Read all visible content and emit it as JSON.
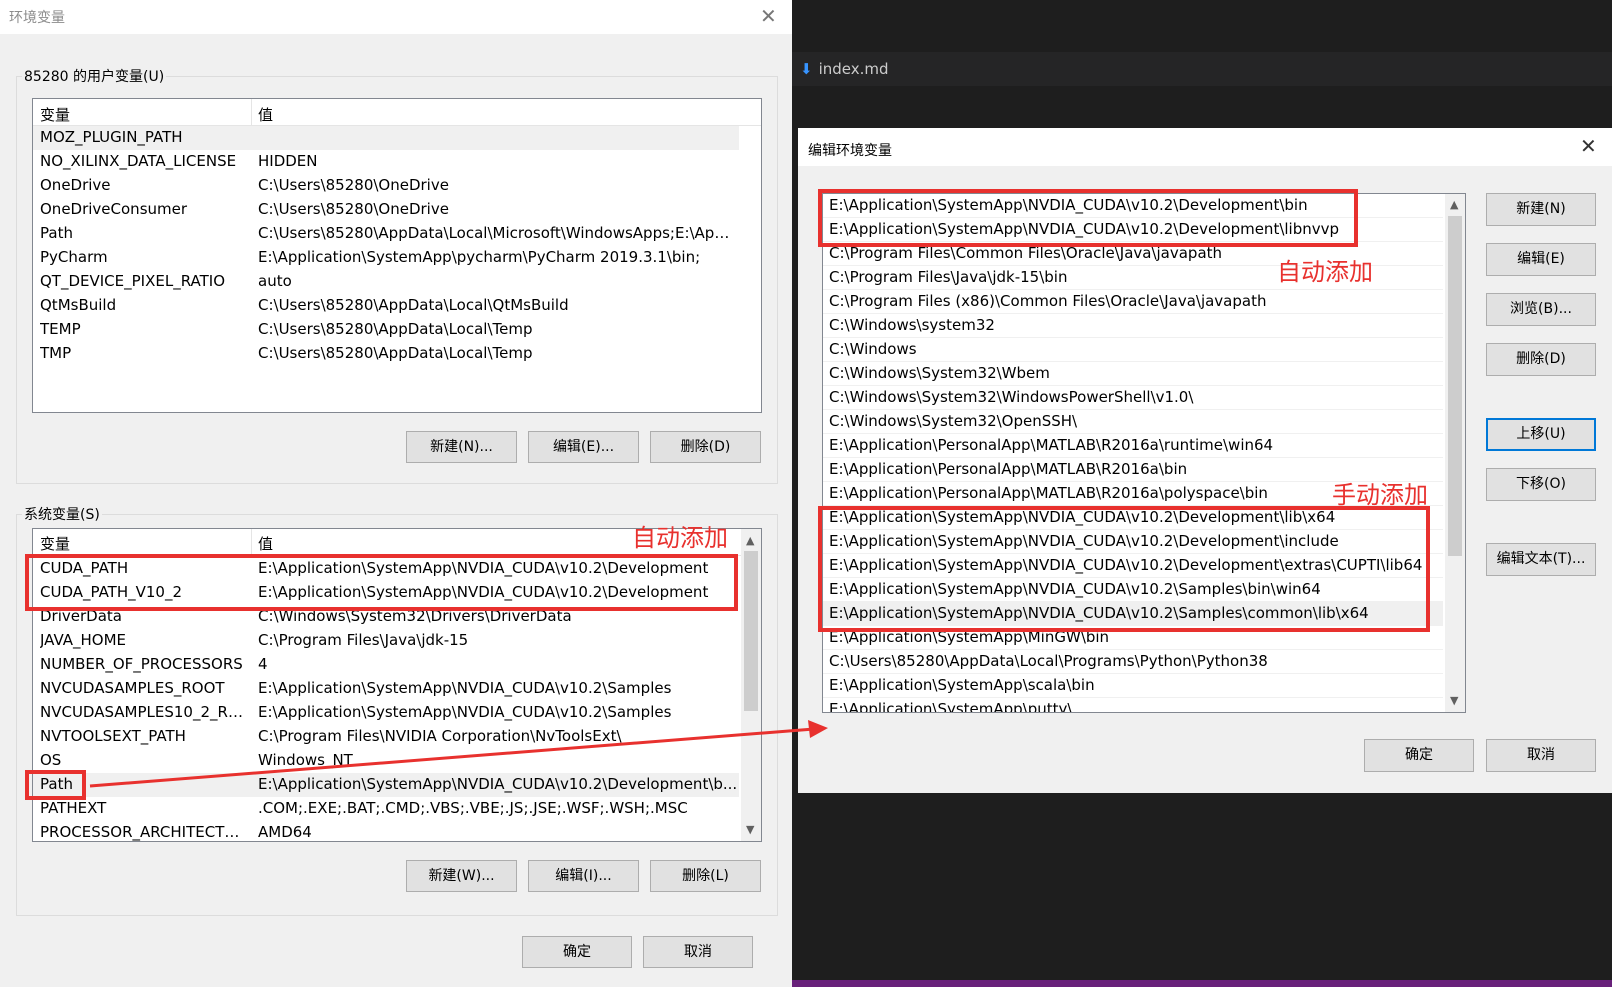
{
  "env_dialog": {
    "title": "环境变量",
    "close": "✕",
    "user_group_label": "85280 的用户变量(U)",
    "columns": [
      "变量",
      "值"
    ],
    "user_vars": [
      {
        "name": "MOZ_PLUGIN_PATH",
        "value": ""
      },
      {
        "name": "NO_XILINX_DATA_LICENSE",
        "value": "HIDDEN"
      },
      {
        "name": "OneDrive",
        "value": "C:\\Users\\85280\\OneDrive"
      },
      {
        "name": "OneDriveConsumer",
        "value": "C:\\Users\\85280\\OneDrive"
      },
      {
        "name": "Path",
        "value": "C:\\Users\\85280\\AppData\\Local\\Microsoft\\WindowsApps;E:\\Applic..."
      },
      {
        "name": "PyCharm",
        "value": "E:\\Application\\SystemApp\\pycharm\\PyCharm 2019.3.1\\bin;"
      },
      {
        "name": "QT_DEVICE_PIXEL_RATIO",
        "value": "auto"
      },
      {
        "name": "QtMsBuild",
        "value": "C:\\Users\\85280\\AppData\\Local\\QtMsBuild"
      },
      {
        "name": "TEMP",
        "value": "C:\\Users\\85280\\AppData\\Local\\Temp"
      },
      {
        "name": "TMP",
        "value": "C:\\Users\\85280\\AppData\\Local\\Temp"
      }
    ],
    "user_buttons": {
      "new": "新建(N)...",
      "edit": "编辑(E)...",
      "delete": "删除(D)"
    },
    "system_group_label": "系统变量(S)",
    "system_vars": [
      {
        "name": "CUDA_PATH",
        "value": "E:\\Application\\SystemApp\\NVDIA_CUDA\\v10.2\\Development"
      },
      {
        "name": "CUDA_PATH_V10_2",
        "value": "E:\\Application\\SystemApp\\NVDIA_CUDA\\v10.2\\Development"
      },
      {
        "name": "DriverData",
        "value": "C:\\Windows\\System32\\Drivers\\DriverData"
      },
      {
        "name": "JAVA_HOME",
        "value": "C:\\Program Files\\Java\\jdk-15"
      },
      {
        "name": "NUMBER_OF_PROCESSORS",
        "value": "4"
      },
      {
        "name": "NVCUDASAMPLES_ROOT",
        "value": "E:\\Application\\SystemApp\\NVDIA_CUDA\\v10.2\\Samples"
      },
      {
        "name": "NVCUDASAMPLES10_2_RO...",
        "value": "E:\\Application\\SystemApp\\NVDIA_CUDA\\v10.2\\Samples"
      },
      {
        "name": "NVTOOLSEXT_PATH",
        "value": "C:\\Program Files\\NVIDIA Corporation\\NvToolsExt\\"
      },
      {
        "name": "OS",
        "value": "Windows_NT"
      },
      {
        "name": "Path",
        "value": "E:\\Application\\SystemApp\\NVDIA_CUDA\\v10.2\\Development\\b..."
      },
      {
        "name": "PATHEXT",
        "value": ".COM;.EXE;.BAT;.CMD;.VBS;.VBE;.JS;.JSE;.WSF;.WSH;.MSC"
      },
      {
        "name": "PROCESSOR_ARCHITECTURE",
        "value": "AMD64"
      }
    ],
    "system_buttons": {
      "new": "新建(W)...",
      "edit": "编辑(I)...",
      "delete": "删除(L)"
    },
    "ok": "确定",
    "cancel": "取消"
  },
  "editor": {
    "tab_label": "index.md",
    "tab_icon": "markdown-arrow-icon"
  },
  "edit_dialog": {
    "title": "编辑环境变量",
    "close": "✕",
    "paths": [
      "E:\\Application\\SystemApp\\NVDIA_CUDA\\v10.2\\Development\\bin",
      "E:\\Application\\SystemApp\\NVDIA_CUDA\\v10.2\\Development\\libnvvp",
      "C:\\Program Files\\Common Files\\Oracle\\Java\\javapath",
      "C:\\Program Files\\Java\\jdk-15\\bin",
      "C:\\Program Files (x86)\\Common Files\\Oracle\\Java\\javapath",
      "C:\\Windows\\system32",
      "C:\\Windows",
      "C:\\Windows\\System32\\Wbem",
      "C:\\Windows\\System32\\WindowsPowerShell\\v1.0\\",
      "C:\\Windows\\System32\\OpenSSH\\",
      "E:\\Application\\PersonalApp\\MATLAB\\R2016a\\runtime\\win64",
      "E:\\Application\\PersonalApp\\MATLAB\\R2016a\\bin",
      "E:\\Application\\PersonalApp\\MATLAB\\R2016a\\polyspace\\bin",
      "E:\\Application\\SystemApp\\NVDIA_CUDA\\v10.2\\Development\\lib\\x64",
      "E:\\Application\\SystemApp\\NVDIA_CUDA\\v10.2\\Development\\include",
      "E:\\Application\\SystemApp\\NVDIA_CUDA\\v10.2\\Development\\extras\\CUPTI\\lib64",
      "E:\\Application\\SystemApp\\NVDIA_CUDA\\v10.2\\Samples\\bin\\win64",
      "E:\\Application\\SystemApp\\NVDIA_CUDA\\v10.2\\Samples\\common\\lib\\x64",
      "E:\\Application\\SystemApp\\MinGW\\bin",
      "C:\\Users\\85280\\AppData\\Local\\Programs\\Python\\Python38",
      "E:\\Application\\SystemApp\\scala\\bin",
      "E:\\Application\\SystemApp\\putty\\"
    ],
    "buttons": {
      "new": "新建(N)",
      "edit": "编辑(E)",
      "browse": "浏览(B)...",
      "delete": "删除(D)",
      "move_up": "上移(U)",
      "move_down": "下移(O)",
      "edit_text": "编辑文本(T)..."
    },
    "ok": "确定",
    "cancel": "取消"
  },
  "annotations": {
    "auto_added_left": "自动添加",
    "auto_added_right": "自动添加",
    "manual_added": "手动添加",
    "color": "#e8312e"
  }
}
